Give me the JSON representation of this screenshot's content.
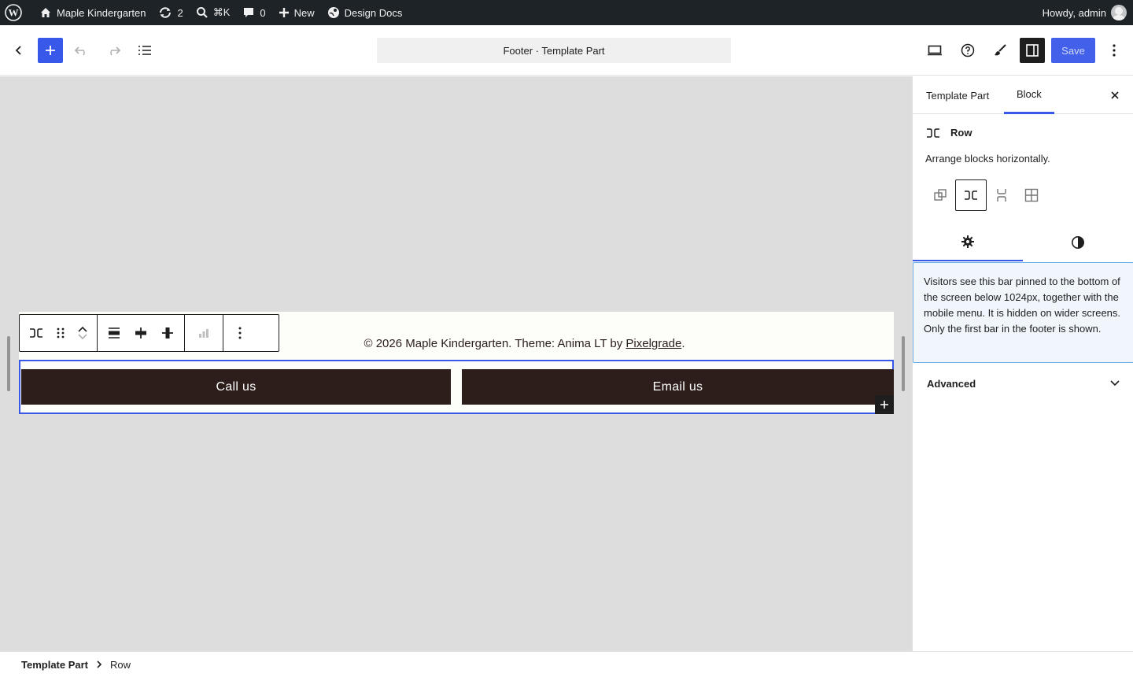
{
  "adminbar": {
    "site_name": "Maple Kindergarten",
    "updates_count": "2",
    "search_shortcut": "⌘K",
    "comments_count": "0",
    "new_label": "New",
    "design_docs_label": "Design Docs",
    "greeting": "Howdy, admin"
  },
  "header": {
    "document_title": "Footer · Template Part",
    "save_label": "Save"
  },
  "canvas": {
    "copyright_prefix": "© 2026 Maple Kindergarten. Theme: Anima LT by ",
    "copyright_link": "Pixelgrade",
    "copyright_suffix": ".",
    "buttons": [
      "Call us",
      "Email us"
    ]
  },
  "sidebar": {
    "tabs": [
      "Template Part",
      "Block"
    ],
    "active_tab": "Block",
    "block_name": "Row",
    "block_description": "Arrange blocks horizontally.",
    "notice": "Visitors see this bar pinned to the bottom of the screen below 1024px, together with the mobile menu. It is hidden on wider screens. Only the first bar in the footer is shown.",
    "advanced_label": "Advanced"
  },
  "breadcrumbs": [
    "Template Part",
    "Row"
  ],
  "colors": {
    "accent": "#3858e9",
    "button_bg": "#2d1e1b",
    "adminbar_bg": "#1d2327",
    "canvas_bg": "#dddddd"
  }
}
